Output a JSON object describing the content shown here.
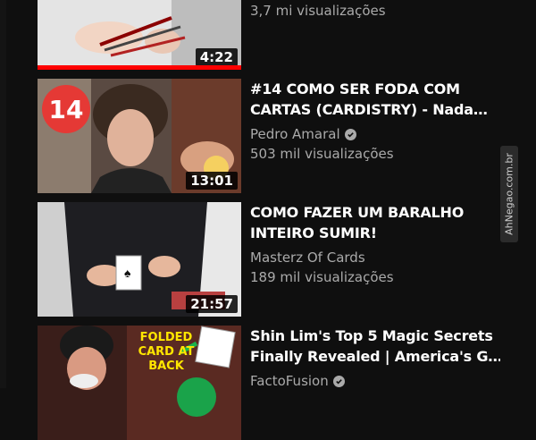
{
  "videos": [
    {
      "title_line1": "",
      "title_line2": "",
      "channel": "",
      "views": "3,7 mi visualizações",
      "duration": "4:22",
      "watch_progress": 1.0
    },
    {
      "title_line1": "#14 COMO SER FODA COM",
      "title_line2": "CARTAS (CARDISTRY) - Nada…",
      "channel": "Pedro Amaral",
      "verified": true,
      "views": "503 mil visualizações",
      "duration": "13:01",
      "badge": "14"
    },
    {
      "title_line1": "COMO FAZER UM BARALHO",
      "title_line2": "INTEIRO SUMIR!",
      "channel": "Masterz Of Cards",
      "verified": false,
      "views": "189 mil visualizações",
      "duration": "21:57"
    },
    {
      "title_line1": "Shin Lim's Top 5 Magic Secrets",
      "title_line2": "Finally Revealed | America's G…",
      "channel": "FactoFusion",
      "verified": true,
      "thumb_text_1": "FOLDED",
      "thumb_text_2": "CARD AT",
      "thumb_text_3": "BACK"
    }
  ],
  "watermark": "AhNegao.com.br",
  "colors": {
    "background": "#0f0f0f",
    "title": "#ffffff",
    "secondary_text": "#aaaaaa",
    "progress": "#ff0000",
    "badge": "#e53935",
    "thumb_text": "#ffe600"
  }
}
